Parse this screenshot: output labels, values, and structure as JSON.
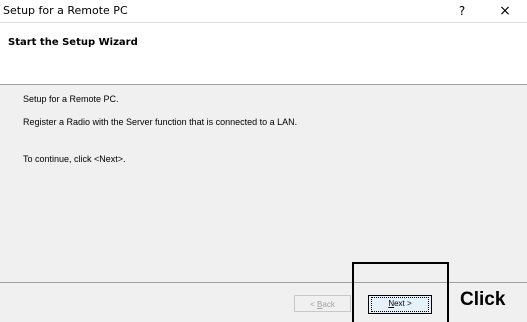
{
  "window": {
    "title": "Setup for a Remote PC",
    "help_symbol": "?",
    "close_symbol": "×"
  },
  "header": {
    "title": "Start the Setup Wizard"
  },
  "body": {
    "line1": "Setup for a Remote PC.",
    "line2": "Register a Radio with the Server function that is connected to a LAN.",
    "line3": "To continue, click <Next>."
  },
  "footer": {
    "back_label_prefix": "< ",
    "back_label_accel": "B",
    "back_label_rest": "ack",
    "next_label_accel": "N",
    "next_label_rest": "ext >"
  },
  "annotation": {
    "click_label": "Click"
  }
}
